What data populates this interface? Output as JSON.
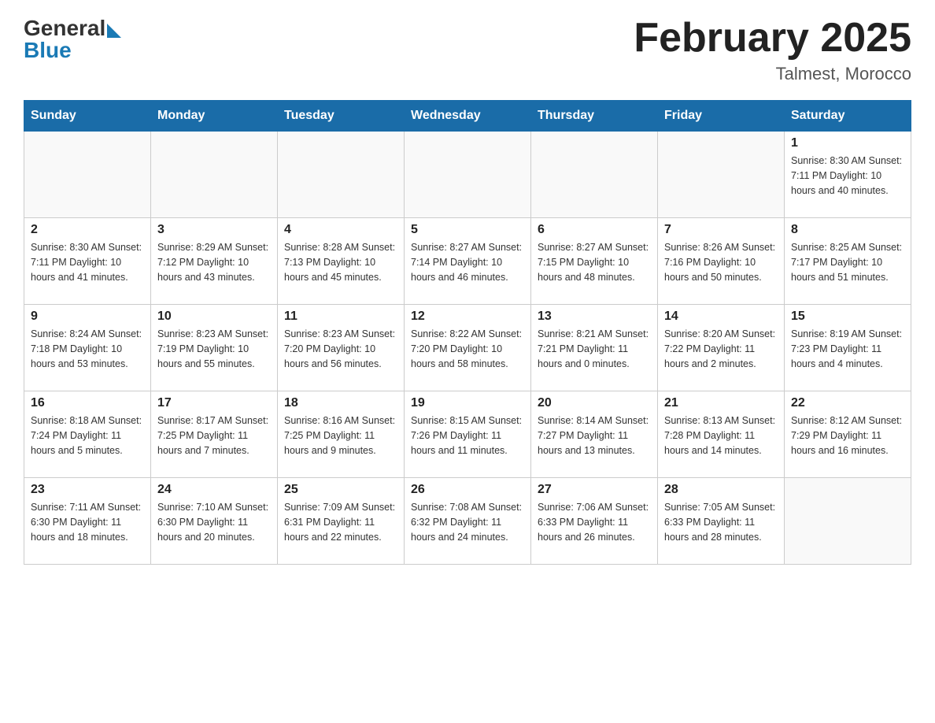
{
  "header": {
    "logo_general": "General",
    "logo_blue": "Blue",
    "title": "February 2025",
    "subtitle": "Talmest, Morocco"
  },
  "days_of_week": [
    "Sunday",
    "Monday",
    "Tuesday",
    "Wednesday",
    "Thursday",
    "Friday",
    "Saturday"
  ],
  "weeks": [
    {
      "days": [
        {
          "num": "",
          "info": ""
        },
        {
          "num": "",
          "info": ""
        },
        {
          "num": "",
          "info": ""
        },
        {
          "num": "",
          "info": ""
        },
        {
          "num": "",
          "info": ""
        },
        {
          "num": "",
          "info": ""
        },
        {
          "num": "1",
          "info": "Sunrise: 8:30 AM\nSunset: 7:11 PM\nDaylight: 10 hours and 40 minutes."
        }
      ]
    },
    {
      "days": [
        {
          "num": "2",
          "info": "Sunrise: 8:30 AM\nSunset: 7:11 PM\nDaylight: 10 hours and 41 minutes."
        },
        {
          "num": "3",
          "info": "Sunrise: 8:29 AM\nSunset: 7:12 PM\nDaylight: 10 hours and 43 minutes."
        },
        {
          "num": "4",
          "info": "Sunrise: 8:28 AM\nSunset: 7:13 PM\nDaylight: 10 hours and 45 minutes."
        },
        {
          "num": "5",
          "info": "Sunrise: 8:27 AM\nSunset: 7:14 PM\nDaylight: 10 hours and 46 minutes."
        },
        {
          "num": "6",
          "info": "Sunrise: 8:27 AM\nSunset: 7:15 PM\nDaylight: 10 hours and 48 minutes."
        },
        {
          "num": "7",
          "info": "Sunrise: 8:26 AM\nSunset: 7:16 PM\nDaylight: 10 hours and 50 minutes."
        },
        {
          "num": "8",
          "info": "Sunrise: 8:25 AM\nSunset: 7:17 PM\nDaylight: 10 hours and 51 minutes."
        }
      ]
    },
    {
      "days": [
        {
          "num": "9",
          "info": "Sunrise: 8:24 AM\nSunset: 7:18 PM\nDaylight: 10 hours and 53 minutes."
        },
        {
          "num": "10",
          "info": "Sunrise: 8:23 AM\nSunset: 7:19 PM\nDaylight: 10 hours and 55 minutes."
        },
        {
          "num": "11",
          "info": "Sunrise: 8:23 AM\nSunset: 7:20 PM\nDaylight: 10 hours and 56 minutes."
        },
        {
          "num": "12",
          "info": "Sunrise: 8:22 AM\nSunset: 7:20 PM\nDaylight: 10 hours and 58 minutes."
        },
        {
          "num": "13",
          "info": "Sunrise: 8:21 AM\nSunset: 7:21 PM\nDaylight: 11 hours and 0 minutes."
        },
        {
          "num": "14",
          "info": "Sunrise: 8:20 AM\nSunset: 7:22 PM\nDaylight: 11 hours and 2 minutes."
        },
        {
          "num": "15",
          "info": "Sunrise: 8:19 AM\nSunset: 7:23 PM\nDaylight: 11 hours and 4 minutes."
        }
      ]
    },
    {
      "days": [
        {
          "num": "16",
          "info": "Sunrise: 8:18 AM\nSunset: 7:24 PM\nDaylight: 11 hours and 5 minutes."
        },
        {
          "num": "17",
          "info": "Sunrise: 8:17 AM\nSunset: 7:25 PM\nDaylight: 11 hours and 7 minutes."
        },
        {
          "num": "18",
          "info": "Sunrise: 8:16 AM\nSunset: 7:25 PM\nDaylight: 11 hours and 9 minutes."
        },
        {
          "num": "19",
          "info": "Sunrise: 8:15 AM\nSunset: 7:26 PM\nDaylight: 11 hours and 11 minutes."
        },
        {
          "num": "20",
          "info": "Sunrise: 8:14 AM\nSunset: 7:27 PM\nDaylight: 11 hours and 13 minutes."
        },
        {
          "num": "21",
          "info": "Sunrise: 8:13 AM\nSunset: 7:28 PM\nDaylight: 11 hours and 14 minutes."
        },
        {
          "num": "22",
          "info": "Sunrise: 8:12 AM\nSunset: 7:29 PM\nDaylight: 11 hours and 16 minutes."
        }
      ]
    },
    {
      "days": [
        {
          "num": "23",
          "info": "Sunrise: 7:11 AM\nSunset: 6:30 PM\nDaylight: 11 hours and 18 minutes."
        },
        {
          "num": "24",
          "info": "Sunrise: 7:10 AM\nSunset: 6:30 PM\nDaylight: 11 hours and 20 minutes."
        },
        {
          "num": "25",
          "info": "Sunrise: 7:09 AM\nSunset: 6:31 PM\nDaylight: 11 hours and 22 minutes."
        },
        {
          "num": "26",
          "info": "Sunrise: 7:08 AM\nSunset: 6:32 PM\nDaylight: 11 hours and 24 minutes."
        },
        {
          "num": "27",
          "info": "Sunrise: 7:06 AM\nSunset: 6:33 PM\nDaylight: 11 hours and 26 minutes."
        },
        {
          "num": "28",
          "info": "Sunrise: 7:05 AM\nSunset: 6:33 PM\nDaylight: 11 hours and 28 minutes."
        },
        {
          "num": "",
          "info": ""
        }
      ]
    }
  ]
}
